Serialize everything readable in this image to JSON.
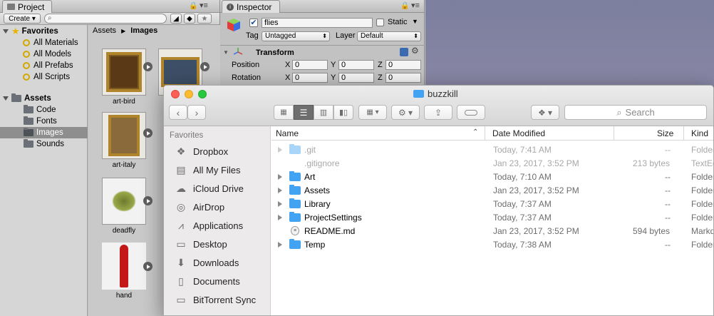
{
  "project": {
    "tab_label": "Project",
    "create_label": "Create ▾",
    "favorites_label": "Favorites",
    "favorites": [
      "All Materials",
      "All Models",
      "All Prefabs",
      "All Scripts"
    ],
    "assets_label": "Assets",
    "asset_folders": [
      "Code",
      "Fonts",
      "Images",
      "Sounds"
    ],
    "selected_folder": "Images",
    "breadcrumb": [
      "Assets",
      "Images"
    ],
    "grid_items": [
      "art-bird",
      "art-italy",
      "deadfly",
      "hand"
    ]
  },
  "inspector": {
    "tab_label": "Inspector",
    "object_name": "flies",
    "static_label": "Static",
    "tag_label": "Tag",
    "tag_value": "Untagged",
    "layer_label": "Layer",
    "layer_value": "Default",
    "component_title": "Transform",
    "position_label": "Position",
    "rotation_label": "Rotation",
    "axis_x": "X",
    "axis_y": "Y",
    "axis_z": "Z",
    "position": {
      "x": "0",
      "y": "0",
      "z": "0"
    },
    "rotation": {
      "x": "0",
      "y": "0",
      "z": "0"
    }
  },
  "finder": {
    "title": "buzzkill",
    "search_placeholder": "Search",
    "sidebar_heading": "Favorites",
    "sidebar_items": [
      {
        "label": "Dropbox",
        "icon": "dropbox-icon"
      },
      {
        "label": "All My Files",
        "icon": "all-my-files-icon"
      },
      {
        "label": "iCloud Drive",
        "icon": "icloud-icon"
      },
      {
        "label": "AirDrop",
        "icon": "airdrop-icon"
      },
      {
        "label": "Applications",
        "icon": "applications-icon"
      },
      {
        "label": "Desktop",
        "icon": "desktop-icon"
      },
      {
        "label": "Downloads",
        "icon": "downloads-icon"
      },
      {
        "label": "Documents",
        "icon": "documents-icon"
      },
      {
        "label": "BitTorrent Sync",
        "icon": "folder-icon"
      }
    ],
    "columns": {
      "name": "Name",
      "date": "Date Modified",
      "size": "Size",
      "kind": "Kind"
    },
    "rows": [
      {
        "name": ".git",
        "date": "Today, 7:41 AM",
        "size": "--",
        "kind": "Folder",
        "type": "folder",
        "hidden": true
      },
      {
        "name": ".gitignore",
        "date": "Jan 23, 2017, 3:52 PM",
        "size": "213 bytes",
        "kind": "TextEdit",
        "type": "file",
        "hidden": true
      },
      {
        "name": "Art",
        "date": "Today, 7:10 AM",
        "size": "--",
        "kind": "Folder",
        "type": "folder",
        "hidden": false
      },
      {
        "name": "Assets",
        "date": "Jan 23, 2017, 3:52 PM",
        "size": "--",
        "kind": "Folder",
        "type": "folder",
        "hidden": false
      },
      {
        "name": "Library",
        "date": "Today, 7:37 AM",
        "size": "--",
        "kind": "Folder",
        "type": "folder",
        "hidden": false
      },
      {
        "name": "ProjectSettings",
        "date": "Today, 7:37 AM",
        "size": "--",
        "kind": "Folder",
        "type": "folder",
        "hidden": false
      },
      {
        "name": "README.md",
        "date": "Jan 23, 2017, 3:52 PM",
        "size": "594 bytes",
        "kind": "Markdown",
        "type": "file",
        "hidden": false
      },
      {
        "name": "Temp",
        "date": "Today, 7:38 AM",
        "size": "--",
        "kind": "Folder",
        "type": "folder",
        "hidden": false
      }
    ]
  },
  "colors": {
    "folder_blue": "#43a3f3",
    "unity_bg": "#c2c2c2",
    "selection": "#8e8e8e"
  }
}
